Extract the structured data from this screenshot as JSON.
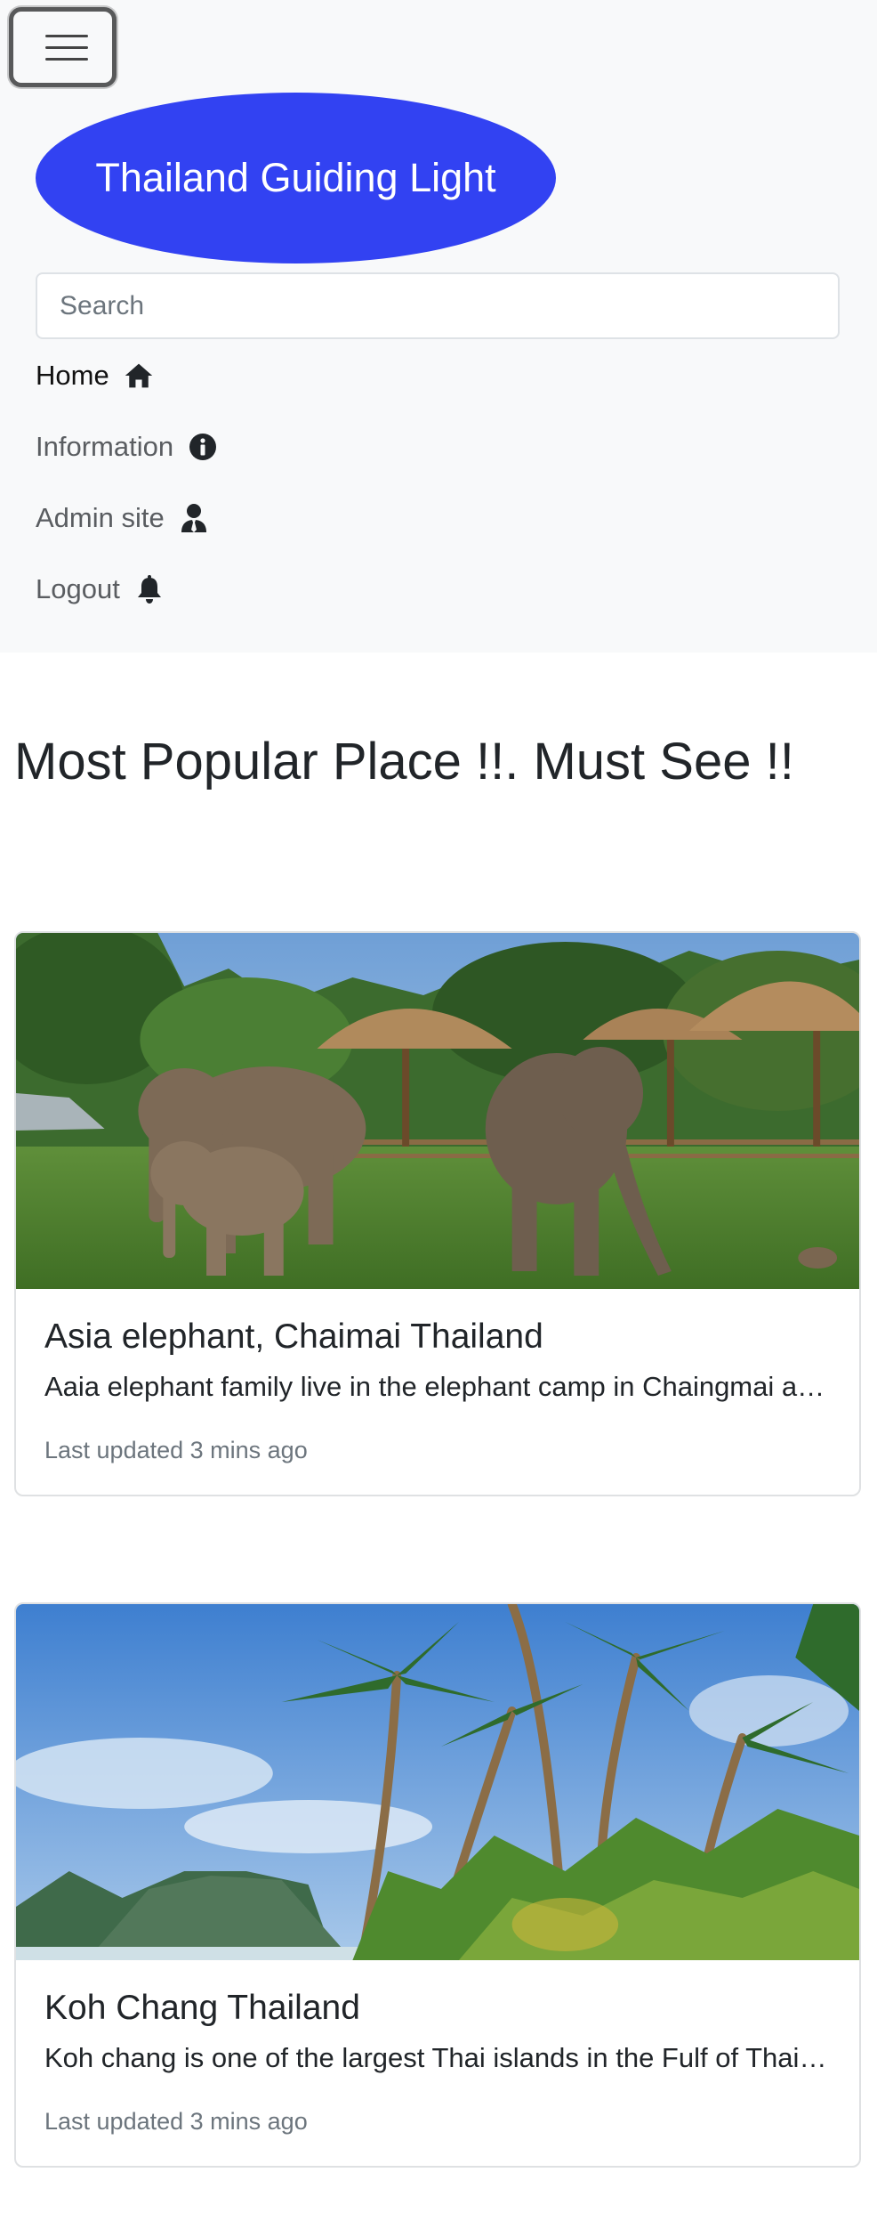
{
  "navbar": {
    "toggler_icon": "hamburger-menu-icon",
    "brand": "Thailand Guiding Light",
    "brand_color": "#3242f2",
    "search": {
      "placeholder": "Search",
      "value": ""
    },
    "links": [
      {
        "label": "Home",
        "icon": "home-icon",
        "active": true
      },
      {
        "label": "Information",
        "icon": "info-circle-icon",
        "active": false
      },
      {
        "label": "Admin site",
        "icon": "user-tie-icon",
        "active": false
      },
      {
        "label": "Logout",
        "icon": "bell-icon",
        "active": false
      }
    ]
  },
  "main": {
    "heading": "Most Popular Place !!. Must See !!",
    "cards": [
      {
        "title": "Asia elephant, Chaimai Thailand",
        "text": "Aaia elephant family live in the elephant camp in Chaingmai and they are happy",
        "updated": "Last updated 3 mins ago",
        "image": "elephants-photo"
      },
      {
        "title": "Koh Chang Thailand",
        "text": "Koh chang is one of the largest Thai islands in the Fulf of Thailand",
        "updated": "Last updated 3 mins ago",
        "image": "palm-beach-photo"
      }
    ]
  }
}
